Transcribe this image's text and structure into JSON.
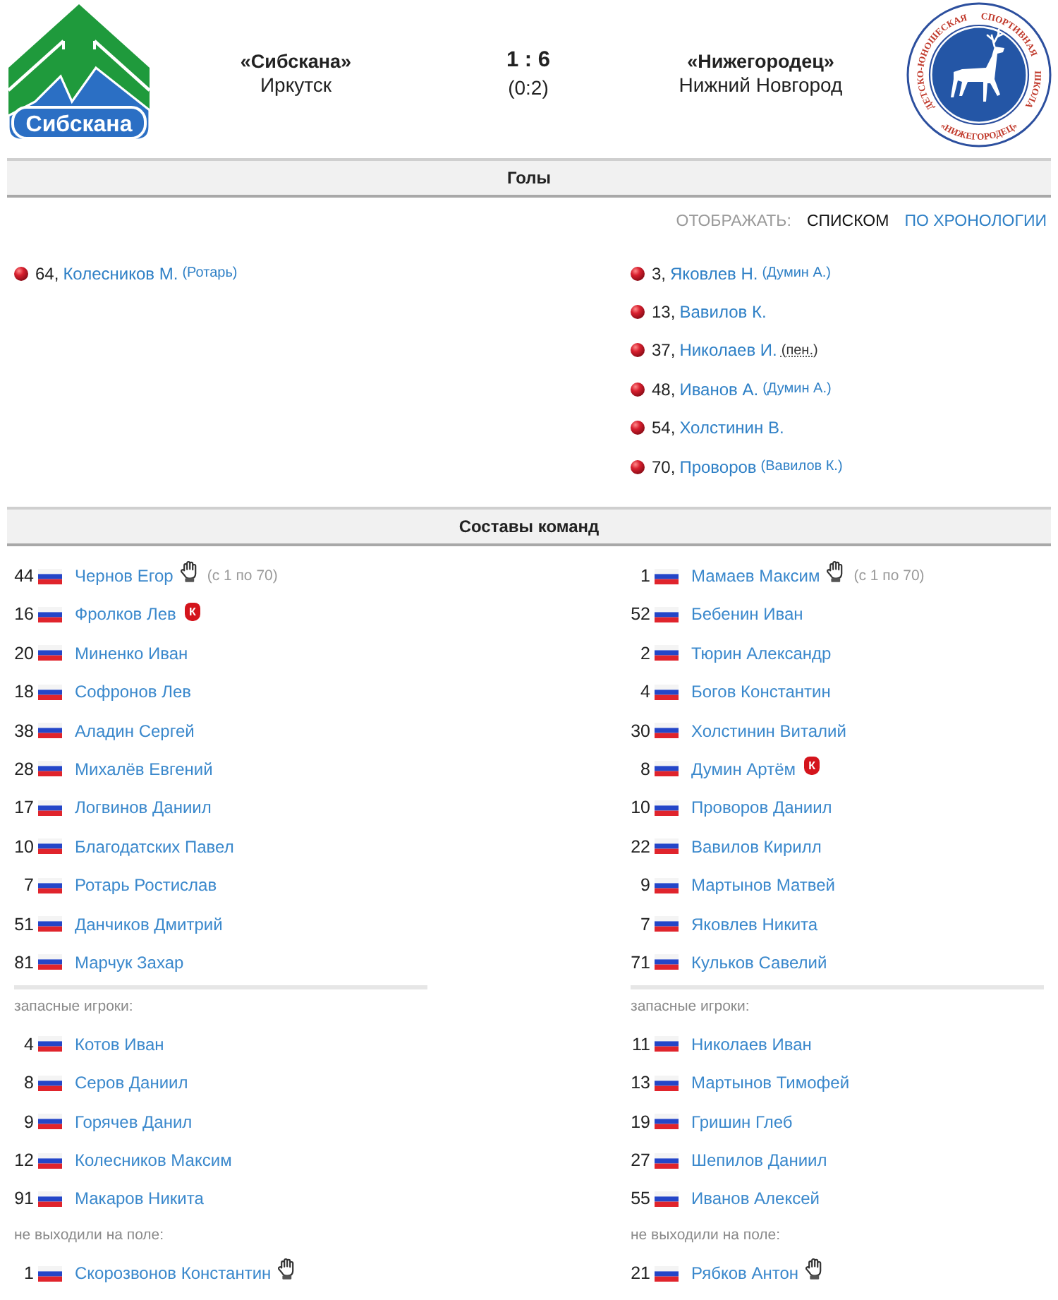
{
  "header": {
    "home": {
      "logo_text": "Сибскана",
      "name": "«Сибскана»",
      "city": "Иркутск"
    },
    "score": "1 : 6",
    "halftime": "(0:2)",
    "away": {
      "logo_ring_words": [
        "ДЕТСКО-ЮНОШЕСКАЯ",
        "СПОРТИВНАЯ",
        "ШКОЛА"
      ],
      "logo_bottom_text": "«НИЖЕГОРОДЕЦ»",
      "name": "«Нижегородец»",
      "city": "Нижний Новгород"
    }
  },
  "goals": {
    "title": "Голы",
    "display": {
      "label": "ОТОБРАЖАТЬ:",
      "options": [
        {
          "label": "СПИСКОМ",
          "selected": true
        },
        {
          "label": "ПО ХРОНОЛОГИИ",
          "selected": false
        }
      ]
    },
    "teams": [
      [
        {
          "minute": "64,",
          "scorer": "Колесников М.",
          "note": {
            "kind": "assist",
            "text": "(Ротарь)"
          }
        }
      ],
      [
        {
          "minute": "3,",
          "scorer": "Яковлев Н.",
          "note": {
            "kind": "assist",
            "text": "(Думин А.)"
          }
        },
        {
          "minute": "13,",
          "scorer": "Вавилов К."
        },
        {
          "minute": "37,",
          "scorer": "Николаев И.",
          "note": {
            "kind": "penalty",
            "text": "(пен.)"
          }
        },
        {
          "minute": "48,",
          "scorer": "Иванов А.",
          "note": {
            "kind": "assist",
            "text": "(Думин А.)"
          }
        },
        {
          "minute": "54,",
          "scorer": "Холстинин В."
        },
        {
          "minute": "70,",
          "scorer": "Проворов",
          "note": {
            "kind": "assist",
            "text": "(Вавилов К.)"
          }
        }
      ]
    ]
  },
  "lineups": {
    "title": "Составы команд",
    "teams": [
      {
        "groups": [
          {
            "kind": "starters",
            "players": [
              {
                "number": "44",
                "name": "Чернов Егор",
                "goalkeeper": true,
                "period": "(с 1 по 70)"
              },
              {
                "number": "16",
                "name": "Фролков Лев",
                "goalkeeper": false,
                "badge": "К"
              },
              {
                "number": "20",
                "name": "Миненко Иван",
                "goalkeeper": false
              },
              {
                "number": "18",
                "name": "Софронов Лев",
                "goalkeeper": false
              },
              {
                "number": "38",
                "name": "Аладин Сергей",
                "goalkeeper": false
              },
              {
                "number": "28",
                "name": "Михалёв Евгений",
                "goalkeeper": false
              },
              {
                "number": "17",
                "name": "Логвинов Даниил",
                "goalkeeper": false
              },
              {
                "number": "10",
                "name": "Благодатских Павел",
                "goalkeeper": false
              },
              {
                "number": "7",
                "name": "Ротарь Ростислав",
                "goalkeeper": false
              },
              {
                "number": "51",
                "name": "Данчиков Дмитрий",
                "goalkeeper": false
              },
              {
                "number": "81",
                "name": "Марчук Захар",
                "goalkeeper": false
              }
            ]
          },
          {
            "kind": "subs",
            "label": "запасные игроки:",
            "players": [
              {
                "number": "4",
                "name": "Котов Иван",
                "goalkeeper": false
              },
              {
                "number": "8",
                "name": "Серов Даниил",
                "goalkeeper": false
              },
              {
                "number": "9",
                "name": "Горячев Данил",
                "goalkeeper": false
              },
              {
                "number": "12",
                "name": "Колесников Максим",
                "goalkeeper": false
              },
              {
                "number": "91",
                "name": "Макаров Никита",
                "goalkeeper": false
              }
            ]
          },
          {
            "kind": "unused",
            "label": "не выходили на поле:",
            "players": [
              {
                "number": "1",
                "name": "Скорозвонов Константин",
                "goalkeeper": true
              }
            ]
          }
        ]
      },
      {
        "groups": [
          {
            "kind": "starters",
            "players": [
              {
                "number": "1",
                "name": "Мамаев Максим",
                "goalkeeper": true,
                "period": "(с 1 по 70)"
              },
              {
                "number": "52",
                "name": "Бебенин Иван",
                "goalkeeper": false
              },
              {
                "number": "2",
                "name": "Тюрин Александр",
                "goalkeeper": false
              },
              {
                "number": "4",
                "name": "Богов Константин",
                "goalkeeper": false
              },
              {
                "number": "30",
                "name": "Холстинин Виталий",
                "goalkeeper": false
              },
              {
                "number": "8",
                "name": "Думин Артём",
                "goalkeeper": false,
                "badge": "К"
              },
              {
                "number": "10",
                "name": "Проворов Даниил",
                "goalkeeper": false
              },
              {
                "number": "22",
                "name": "Вавилов Кирилл",
                "goalkeeper": false
              },
              {
                "number": "9",
                "name": "Мартынов Матвей",
                "goalkeeper": false
              },
              {
                "number": "7",
                "name": "Яковлев Никита",
                "goalkeeper": false
              },
              {
                "number": "71",
                "name": "Кульков Савелий",
                "goalkeeper": false
              }
            ]
          },
          {
            "kind": "subs",
            "label": "запасные игроки:",
            "players": [
              {
                "number": "11",
                "name": "Николаев Иван",
                "goalkeeper": false
              },
              {
                "number": "13",
                "name": "Мартынов Тимофей",
                "goalkeeper": false
              },
              {
                "number": "19",
                "name": "Гришин Глеб",
                "goalkeeper": false
              },
              {
                "number": "27",
                "name": "Шепилов Даниил",
                "goalkeeper": false
              },
              {
                "number": "55",
                "name": "Иванов Алексей",
                "goalkeeper": false
              }
            ]
          },
          {
            "kind": "unused",
            "label": "не выходили на поле:",
            "players": [
              {
                "number": "21",
                "name": "Рябков Антон",
                "goalkeeper": true
              }
            ]
          }
        ]
      }
    ]
  }
}
